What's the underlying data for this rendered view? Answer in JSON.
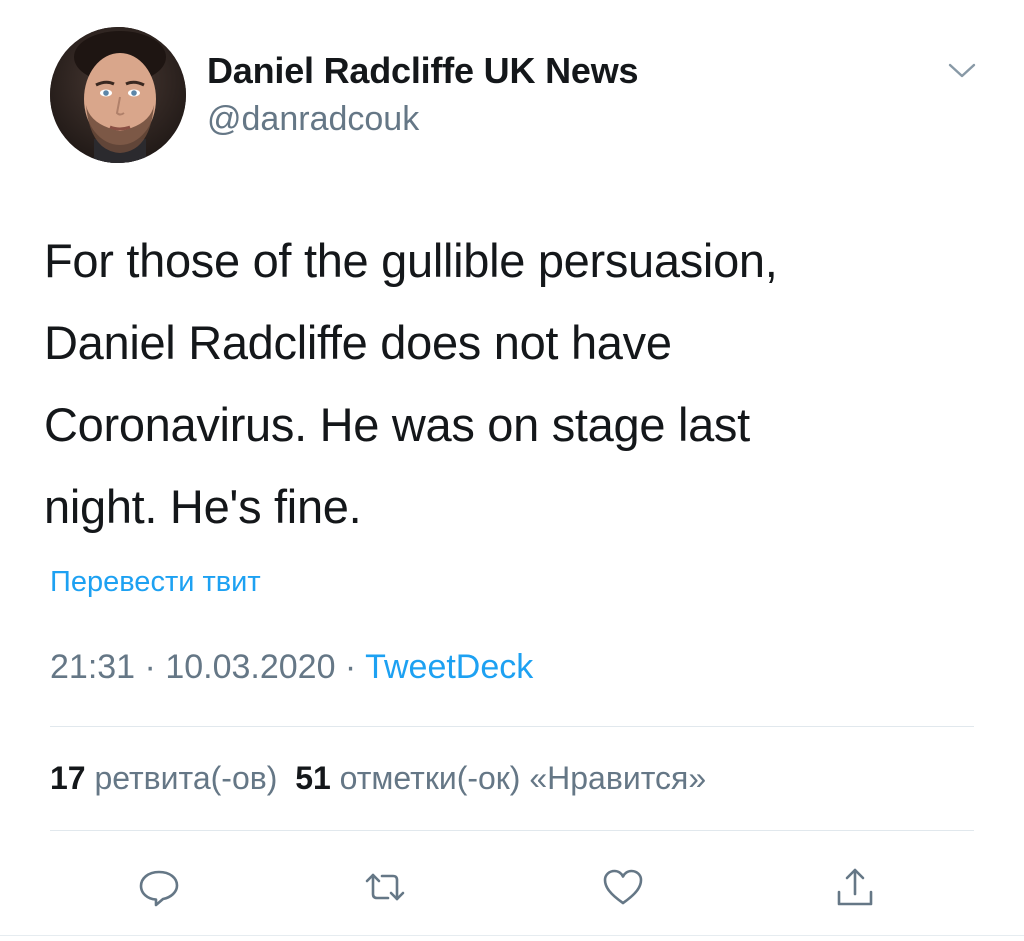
{
  "user": {
    "display_name": "Daniel Radcliffe UK News",
    "handle": "@danradcouk"
  },
  "tweet": {
    "lines": [
      "For those of the gullible persuasion,",
      "Daniel Radcliffe does not have",
      "Coronavirus. He was on stage last",
      "night. He's fine."
    ],
    "translate_label": "Перевести твит",
    "time": "21:31",
    "date": "10.03.2020",
    "source": "TweetDeck",
    "separator": " · "
  },
  "stats": {
    "retweets_count": "17",
    "retweets_label": "ретвита(-ов)",
    "likes_count": "51",
    "likes_label": "отметки(-ок) «Нравится»"
  },
  "actions": {
    "reply_icon": "reply-icon",
    "retweet_icon": "retweet-icon",
    "like_icon": "heart-icon",
    "share_icon": "share-icon"
  },
  "colors": {
    "accent": "#1da1f2",
    "secondary_text": "#657786",
    "primary_text": "#14171a",
    "divider": "#e1e8ed"
  }
}
